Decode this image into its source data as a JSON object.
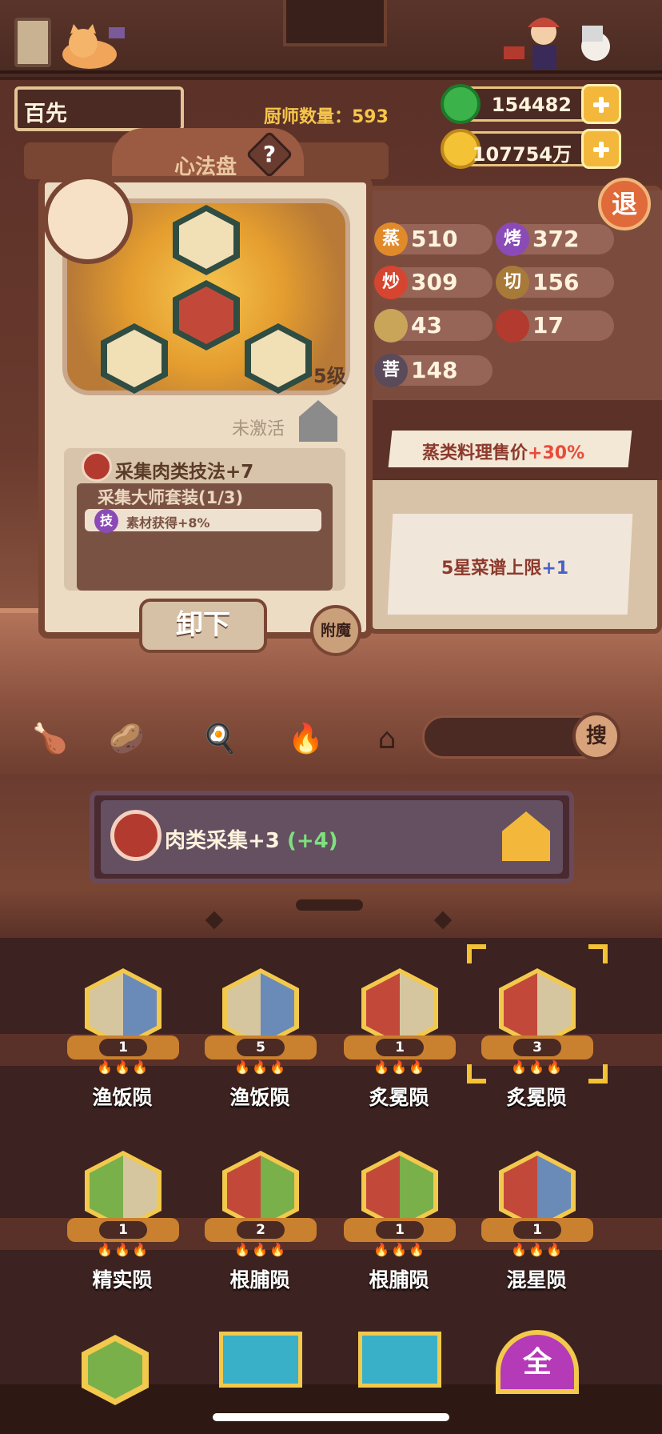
{
  "player": {
    "name": "百先"
  },
  "chef_count_label": "厨师数量：593",
  "currency": {
    "jade": "154482",
    "gold": "107754万"
  },
  "exit_label": "退",
  "stats": [
    {
      "icon": "蒸",
      "value": "510",
      "color": "#e08a2a"
    },
    {
      "icon": "烤",
      "value": "372",
      "color": "#8b4bb6"
    },
    {
      "icon": "炒",
      "value": "309",
      "color": "#d6452f"
    },
    {
      "icon": "切",
      "value": "156",
      "color": "#a87a3a"
    },
    {
      "icon": "",
      "value": "43",
      "color": "#c9a55a"
    },
    {
      "icon": "",
      "value": "17",
      "color": "#b33a2e"
    },
    {
      "icon": "菩",
      "value": "148",
      "color": "#5a4a5a"
    }
  ],
  "ribbons": {
    "first": {
      "text": "蒸类料理售价",
      "bonus": "+30%"
    },
    "second": {
      "text": "5星菜谱上限",
      "bonus": "+1"
    }
  },
  "xinfapan": {
    "title": "心法盘",
    "help": "?",
    "level": "5级",
    "status": "未激活",
    "skill": "采集肉类技法+7",
    "set_title": "采集大师套装(1/3)",
    "set_effect_icon": "技",
    "set_effect": "素材获得+8%",
    "unequip": "卸下",
    "enchant": "附魔"
  },
  "toolbar": {
    "search": "搜"
  },
  "banner": {
    "text": "肉类采集+3",
    "bonus": "(+4)"
  },
  "items": [
    {
      "name": "渔饭陨",
      "count": "1",
      "flames": "🔥🔥🔥",
      "colors": [
        "#d6c6a0",
        "#6a8ab8"
      ]
    },
    {
      "name": "渔饭陨",
      "count": "5",
      "flames": "🔥🔥🔥",
      "colors": [
        "#d6c6a0",
        "#6a8ab8"
      ]
    },
    {
      "name": "炙冕陨",
      "count": "1",
      "flames": "🔥🔥🔥",
      "colors": [
        "#c2493a",
        "#d6c6a0"
      ]
    },
    {
      "name": "炙冕陨",
      "count": "3",
      "flames": "🔥🔥🔥",
      "colors": [
        "#c2493a",
        "#d6c6a0"
      ]
    },
    {
      "name": "精实陨",
      "count": "1",
      "flames": "🔥🔥🔥",
      "colors": [
        "#7ab04a",
        "#d6c6a0"
      ]
    },
    {
      "name": "根脯陨",
      "count": "2",
      "flames": "🔥🔥🔥",
      "colors": [
        "#c2493a",
        "#7ab04a"
      ]
    },
    {
      "name": "根脯陨",
      "count": "1",
      "flames": "🔥🔥🔥",
      "colors": [
        "#c2493a",
        "#7ab04a"
      ]
    },
    {
      "name": "混星陨",
      "count": "1",
      "flames": "🔥🔥🔥",
      "colors": [
        "#c2493a",
        "#6a8ab8"
      ]
    }
  ],
  "partial_row_icon": "全"
}
